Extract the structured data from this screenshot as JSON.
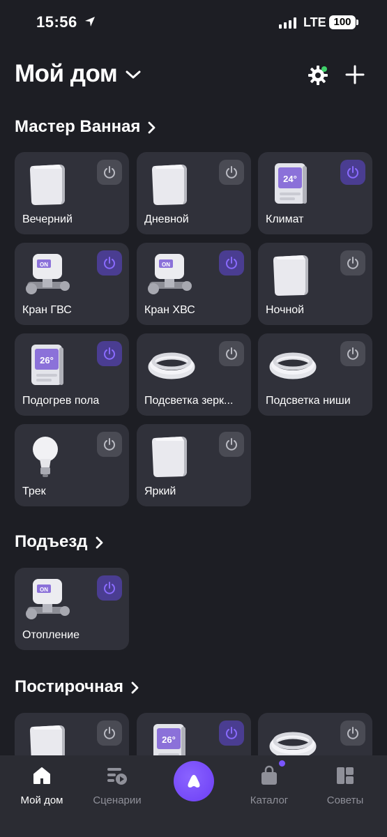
{
  "status_bar": {
    "time": "15:56",
    "network": "LTE",
    "battery": "100"
  },
  "header": {
    "title": "Мой дом"
  },
  "sections": [
    {
      "title": "Мастер Ванная",
      "devices": [
        {
          "label": "Вечерний",
          "icon": "switch-icon",
          "power_on": false
        },
        {
          "label": "Дневной",
          "icon": "switch-icon",
          "power_on": false
        },
        {
          "label": "Климат",
          "icon": "thermostat-icon",
          "display": "24°",
          "power_on": true
        },
        {
          "label": "Кран ГВС",
          "icon": "valve-icon",
          "power_on": true
        },
        {
          "label": "Кран ХВС",
          "icon": "valve-icon",
          "power_on": true
        },
        {
          "label": "Ночной",
          "icon": "switch-icon",
          "power_on": false
        },
        {
          "label": "Подогрев пола",
          "icon": "thermostat-icon",
          "display": "26°",
          "power_on": true
        },
        {
          "label": "Подсветка зерк...",
          "icon": "led-strip-icon",
          "power_on": false
        },
        {
          "label": "Подсветка ниши",
          "icon": "led-strip-icon",
          "power_on": false
        },
        {
          "label": "Трек",
          "icon": "bulb-icon",
          "power_on": false
        },
        {
          "label": "Яркий",
          "icon": "switch-icon",
          "power_on": false
        }
      ]
    },
    {
      "title": "Подъезд",
      "devices": [
        {
          "label": "Отопление",
          "icon": "valve-icon",
          "power_on": true
        }
      ]
    },
    {
      "title": "Постирочная",
      "devices": [
        {
          "label": "",
          "icon": "switch-icon",
          "power_on": false
        },
        {
          "label": "",
          "icon": "thermostat-icon",
          "display": "26°",
          "power_on": true
        },
        {
          "label": "",
          "icon": "led-strip-icon",
          "power_on": false
        }
      ]
    }
  ],
  "bottom_nav": {
    "items": [
      {
        "label": "Мой дом",
        "icon": "home-icon",
        "active": true
      },
      {
        "label": "Сценарии",
        "icon": "scenarios-icon",
        "active": false
      },
      {
        "label": "",
        "icon": "alice-icon",
        "active": false
      },
      {
        "label": "Каталог",
        "icon": "bag-icon",
        "active": false
      },
      {
        "label": "Советы",
        "icon": "tips-icon",
        "active": false
      }
    ]
  },
  "colors": {
    "background": "#1d1e24",
    "card": "#30313a",
    "power_on": "#4a3d91",
    "accent": "#7a55ff",
    "notification_dot": "#3fd16a"
  }
}
